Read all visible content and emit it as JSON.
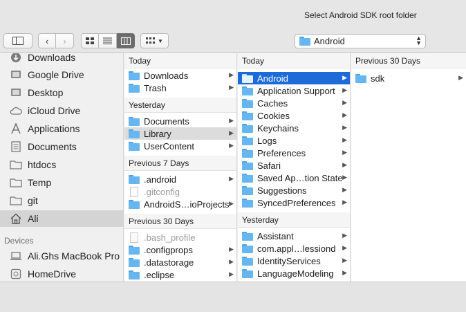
{
  "window": {
    "title": "Select Android SDK root folder"
  },
  "toolbar": {
    "path_label": "Android"
  },
  "sidebar": {
    "favorites": [
      {
        "label": "Downloads",
        "icon": "downloads-icon"
      },
      {
        "label": "Google Drive",
        "icon": "google-drive-icon"
      },
      {
        "label": "Desktop",
        "icon": "desktop-icon"
      },
      {
        "label": "iCloud Drive",
        "icon": "icloud-icon"
      },
      {
        "label": "Applications",
        "icon": "applications-icon"
      },
      {
        "label": "Documents",
        "icon": "documents-icon"
      },
      {
        "label": "htdocs",
        "icon": "folder-icon"
      },
      {
        "label": "Temp",
        "icon": "folder-icon"
      },
      {
        "label": "git",
        "icon": "folder-icon"
      },
      {
        "label": "Ali",
        "icon": "home-icon"
      }
    ],
    "devices_header": "Devices",
    "devices": [
      {
        "label": "Ali.Ghs MacBook Pro",
        "icon": "laptop-icon"
      },
      {
        "label": "HomeDrive",
        "icon": "drive-icon"
      }
    ]
  },
  "col1": {
    "today": "Today",
    "today_items": [
      "Downloads",
      "Trash"
    ],
    "yesterday": "Yesterday",
    "yesterday_items": [
      "Documents",
      "Library",
      "UserContent"
    ],
    "prev7": "Previous 7 Days",
    "prev7_items": [
      ".android",
      ".gitconfig",
      "AndroidS…ioProjects"
    ],
    "prev30": "Previous 30 Days",
    "prev30_items": [
      ".bash_profile",
      ".configprops",
      ".datastorage",
      ".eclipse"
    ]
  },
  "col2": {
    "today": "Today",
    "today_items": [
      "Android",
      "Application Support",
      "Caches",
      "Cookies",
      "Keychains",
      "Logs",
      "Preferences",
      "Safari",
      "Saved Ap…tion State",
      "Suggestions",
      "SyncedPreferences"
    ],
    "yesterday": "Yesterday",
    "yesterday_items": [
      "Assistant",
      "com.appl…lessiond",
      "IdentityServices",
      "LanguageModeling"
    ]
  },
  "col3": {
    "prev30": "Previous 30 Days",
    "items": [
      "sdk"
    ]
  }
}
